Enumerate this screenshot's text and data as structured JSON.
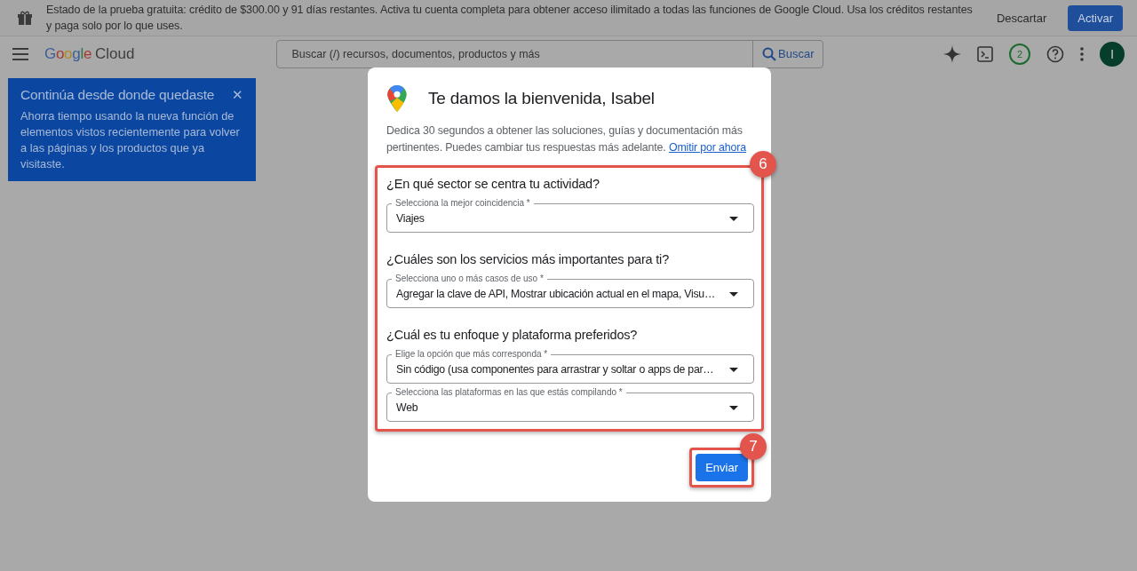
{
  "banner": {
    "text": "Estado de la prueba gratuita: crédito de $300.00 y 91 días restantes. Activa tu cuenta completa para obtener acceso ilimitado a todas las funciones de Google Cloud. Usa los créditos restantes y paga solo por lo que uses.",
    "dismiss": "Descartar",
    "activate": "Activar"
  },
  "toolbar": {
    "logo_word": "Google",
    "logo_product": "Cloud",
    "search_placeholder": "Buscar (/) recursos, documentos, productos y más",
    "search_button": "Buscar",
    "notifications": "2",
    "avatar": "I"
  },
  "tooltip": {
    "title": "Continúa desde donde quedaste",
    "close": "✕",
    "text": "Ahorra tiempo usando la nueva función de elementos vistos recientemente para volver a las páginas y los productos que ya visitaste."
  },
  "dialog": {
    "title": "Te damos la bienvenida, Isabel",
    "intro": "Dedica 30 segundos a obtener las soluciones, guías y documentación más pertinentes. Puedes cambiar tus respuestas más adelante.",
    "skip_link": "Omitir por ahora",
    "questions": [
      {
        "title": "¿En qué sector se centra tu actividad?",
        "fields": [
          {
            "label": "Selecciona la mejor coincidencia *",
            "value": "Viajes"
          }
        ]
      },
      {
        "title": "¿Cuáles son los servicios más importantes para ti?",
        "fields": [
          {
            "label": "Selecciona uno o más casos de uso *",
            "value": "Agregar la clave de API, Mostrar ubicación actual en el mapa, Visu…"
          }
        ]
      },
      {
        "title": "¿Cuál es tu enfoque y plataforma preferidos?",
        "fields": [
          {
            "label": "Elige la opción que más corresponda *",
            "value": "Sin código (usa componentes para arrastrar y soltar o apps de par…"
          },
          {
            "label": "Selecciona las plataformas en las que estás compilando *",
            "value": "Web"
          }
        ]
      }
    ],
    "submit": "Enviar"
  },
  "annotations": [
    {
      "label": "6"
    },
    {
      "label": "7"
    }
  ]
}
